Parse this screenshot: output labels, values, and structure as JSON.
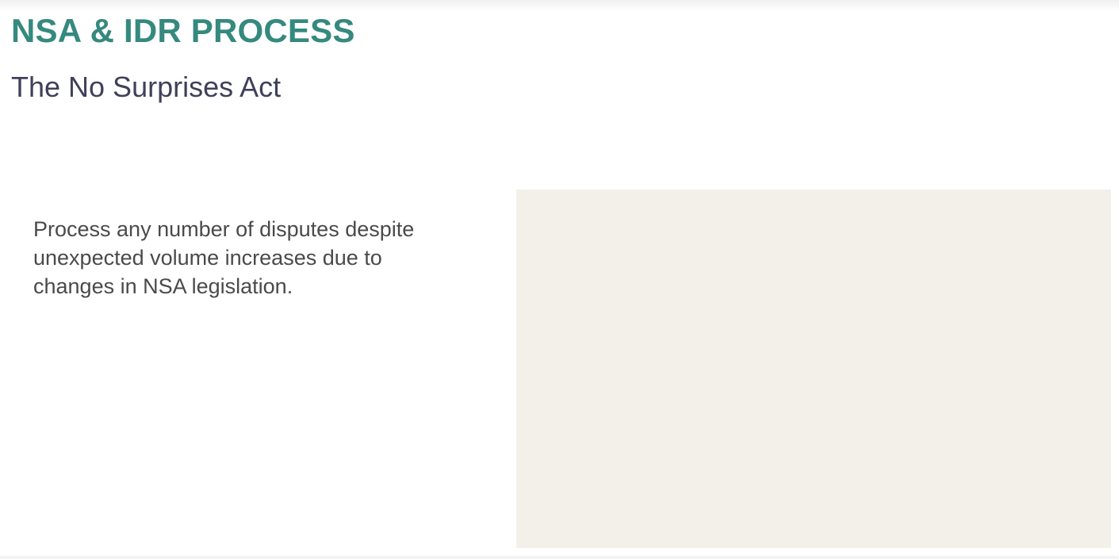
{
  "header": {
    "title": "NSA & IDR PROCESS",
    "subtitle": "The No Surprises Act"
  },
  "main": {
    "description": "Process any number of disputes despite unexpected volume increases due to changes in NSA legislation."
  },
  "colors": {
    "title": "#35897e",
    "subtitle": "#40405a",
    "body_text": "#4a4a4a",
    "panel_background": "#f3f0ea"
  }
}
